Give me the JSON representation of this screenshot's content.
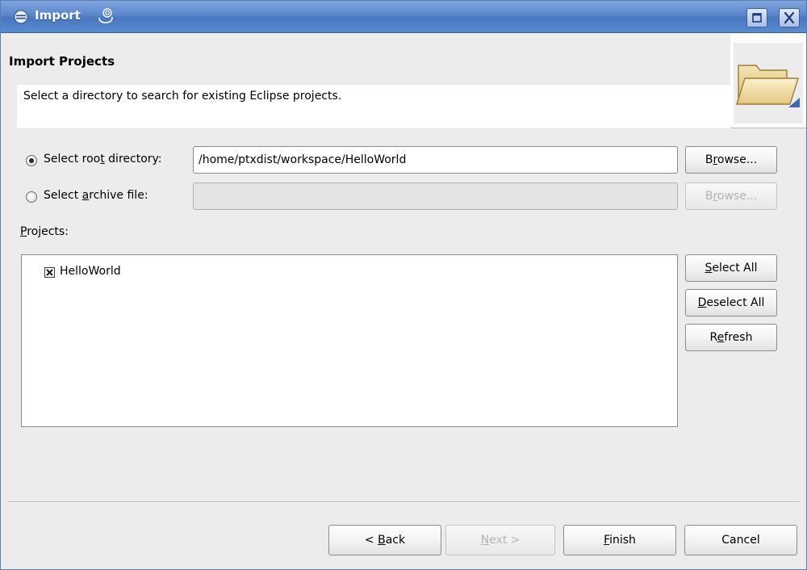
{
  "window": {
    "title": "Import"
  },
  "banner": {
    "title": "Import Projects",
    "message": "Select a directory to search for existing Eclipse projects."
  },
  "source": {
    "root_option": {
      "pre": "Select roo",
      "mnemonic": "t",
      "post": " directory:",
      "selected": true
    },
    "root_value": "/home/ptxdist/workspace/HelloWorld",
    "root_browse": {
      "pre": "B",
      "mnemonic": "r",
      "post": "owse..."
    },
    "archive_option": {
      "pre": "Select ",
      "mnemonic": "a",
      "post": "rchive file:",
      "selected": false
    },
    "archive_value": "",
    "archive_browse": {
      "pre": "B",
      "mnemonic": "r",
      "post": "owse..."
    }
  },
  "projects": {
    "label": {
      "pre": "",
      "mnemonic": "P",
      "post": "rojects:"
    },
    "items": [
      {
        "name": "HelloWorld",
        "checked": true
      }
    ],
    "select_all": {
      "pre": "",
      "mnemonic": "S",
      "post": "elect All"
    },
    "deselect_all": {
      "pre": "",
      "mnemonic": "D",
      "post": "eselect All"
    },
    "refresh": {
      "pre": "R",
      "mnemonic": "e",
      "post": "fresh"
    }
  },
  "footer": {
    "back": {
      "pre": "< ",
      "mnemonic": "B",
      "post": "ack"
    },
    "next": {
      "pre": "",
      "mnemonic": "N",
      "post": "ext >"
    },
    "finish": {
      "pre": "",
      "mnemonic": "F",
      "post": "inish"
    },
    "cancel": "Cancel"
  },
  "icons": {
    "app": "eclipse-icon",
    "title_swirl": "swirl-icon",
    "maximize": "maximize-icon",
    "close": "close-icon",
    "banner_image": "folder-icon",
    "checkbox": "checkbox-checked-icon"
  }
}
